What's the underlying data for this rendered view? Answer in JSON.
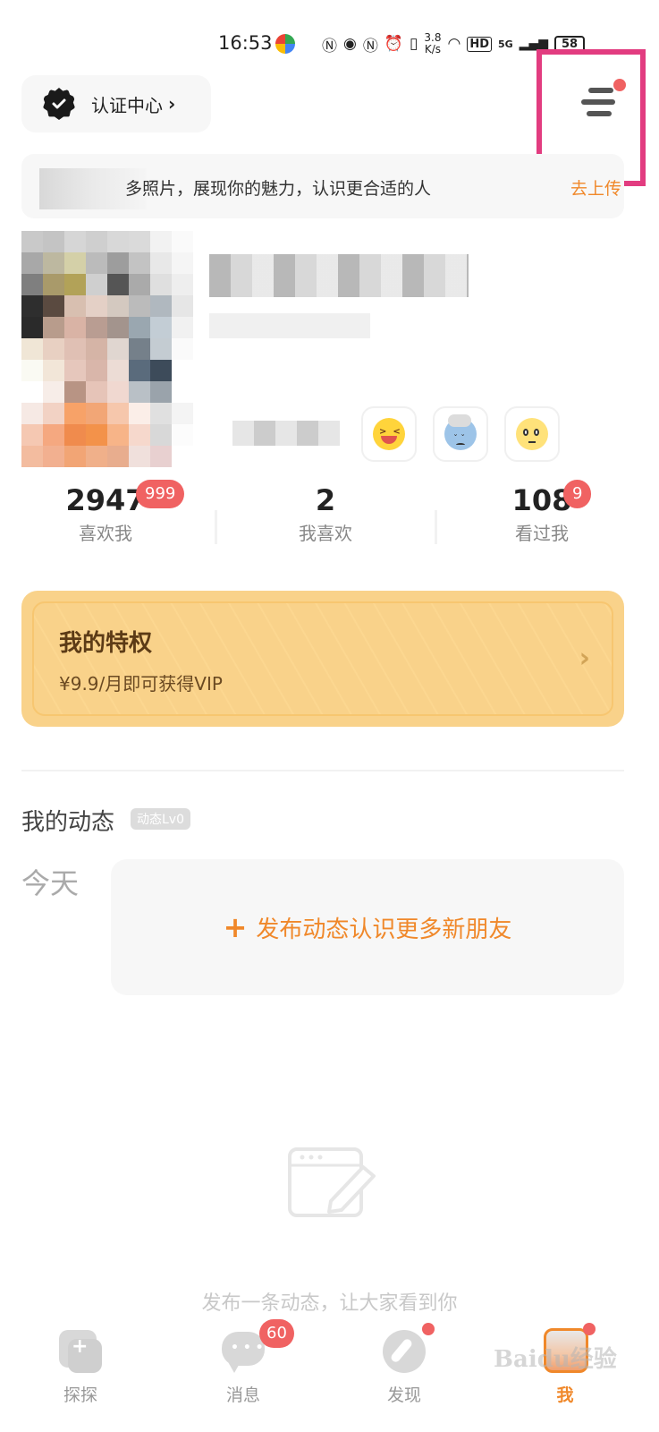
{
  "status_bar": {
    "time": "16:53",
    "speed_top": "3.8",
    "speed_bottom": "K/s",
    "net_hd": "HD",
    "net_5g": "5G",
    "battery": "58"
  },
  "header": {
    "cert_label": "认证中心",
    "cert_chevron": "›"
  },
  "upload_banner": {
    "text": "多照片，展现你的魅力，认识更合适的人",
    "link": "去上传"
  },
  "stats": [
    {
      "value": "2947",
      "label": "喜欢我",
      "badge": "999"
    },
    {
      "value": "2",
      "label": "我喜欢",
      "badge": ""
    },
    {
      "value": "108",
      "label": "看过我",
      "badge": "9"
    }
  ],
  "vip": {
    "title": "我的特权",
    "subtitle": "¥9.9/月即可获得VIP",
    "chevron": "›"
  },
  "moments": {
    "title": "我的动态",
    "level": "动态Lv0",
    "today": "今天",
    "post_plus": "+",
    "post_text": "发布动态认识更多新朋友",
    "empty_text": "发布一条动态，让大家看到你"
  },
  "tabs": [
    {
      "label": "探探",
      "icon": "tantan-icon",
      "badge": ""
    },
    {
      "label": "消息",
      "icon": "message-icon",
      "badge": "60"
    },
    {
      "label": "发现",
      "icon": "compass-icon",
      "badge": ""
    },
    {
      "label": "我",
      "icon": "avatar-icon",
      "badge": ""
    }
  ],
  "watermark": "Baidu经验",
  "colors": {
    "accent": "#f0882a",
    "badge_red": "#f06262",
    "vip_bg": "#f9d28a",
    "highlight": "#e23c80"
  }
}
